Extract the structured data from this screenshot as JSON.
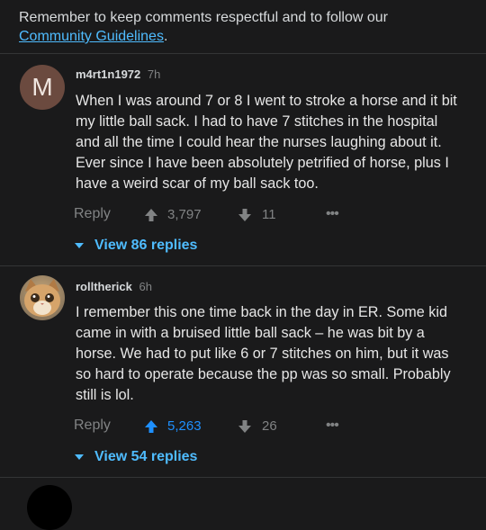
{
  "guidelines": {
    "text": "Remember to keep comments respectful and to follow our",
    "link": "Community Guidelines",
    "suffix": "."
  },
  "comments": [
    {
      "avatar_letter": "M",
      "username": "m4rt1n1972",
      "time": "7h",
      "body": "When I was around 7 or 8 I went to stroke a horse and it bit my little ball sack. I had to have 7 stitches in the hospital and all the time I could hear the nurses laughing about it. Ever since I have been absolutely petrified of horse, plus I have a weird scar of my ball sack too.",
      "reply_label": "Reply",
      "upvotes": "3,797",
      "downvotes": "11",
      "upvoted": false,
      "more": "•••",
      "view_replies": "View 86 replies"
    },
    {
      "username": "rolltherick",
      "time": "6h",
      "body": "I remember this one time back in the day in ER. Some kid came in with a bruised little ball sack – he was bit by a horse. We had to put like 6 or 7 stitches on him, but it was so hard to operate because the pp was so small. Probably still is lol.",
      "reply_label": "Reply",
      "upvotes": "5,263",
      "downvotes": "26",
      "upvoted": true,
      "more": "•••",
      "view_replies": "View 54 replies"
    }
  ],
  "colors": {
    "background": "#1a1a1b",
    "link": "#4fbcff",
    "upvote_active": "#1e90ff",
    "muted": "#818384"
  }
}
